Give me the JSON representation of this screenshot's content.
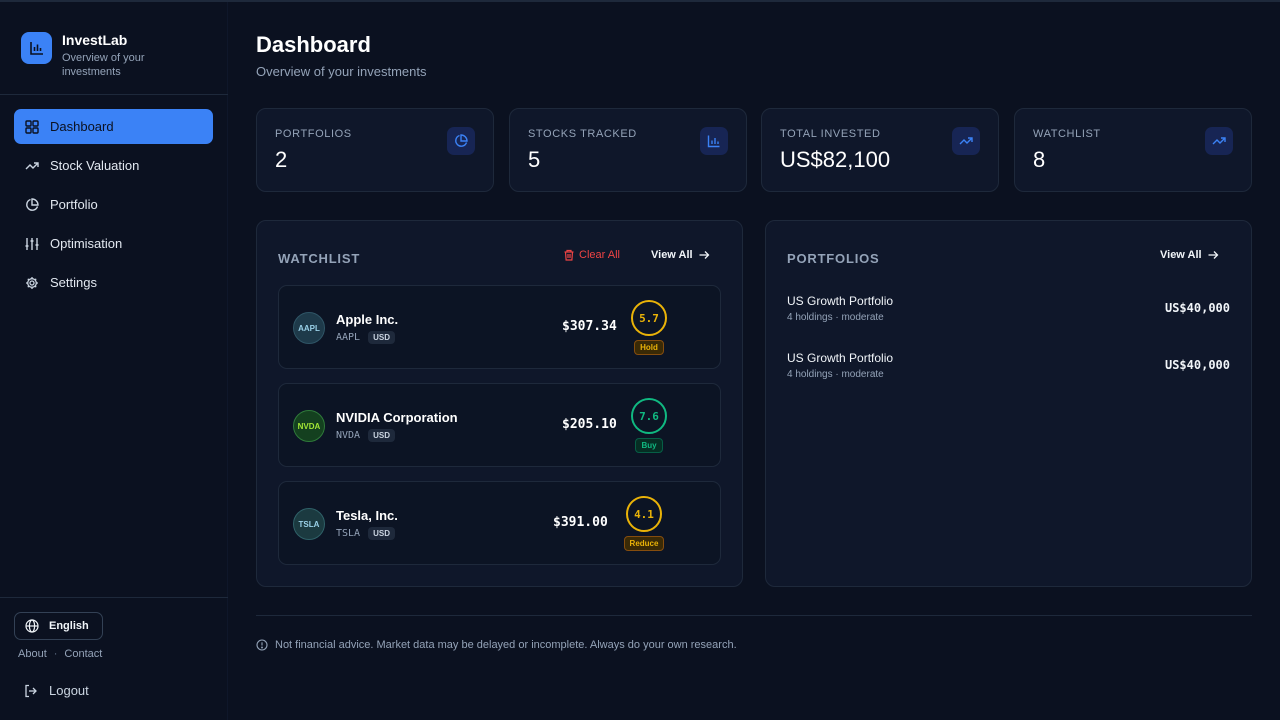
{
  "app": {
    "name": "InvestLab",
    "tagline": "Overview of your investments"
  },
  "sidebar": {
    "items": [
      {
        "label": "Dashboard",
        "icon": "grid-icon",
        "active": true
      },
      {
        "label": "Stock Valuation",
        "icon": "trend-icon",
        "active": false
      },
      {
        "label": "Portfolio",
        "icon": "pie-icon",
        "active": false
      },
      {
        "label": "Optimisation",
        "icon": "sliders-icon",
        "active": false
      },
      {
        "label": "Settings",
        "icon": "gear-icon",
        "active": false
      }
    ],
    "language": "English",
    "links": [
      "About",
      "Contact"
    ],
    "logout": "Logout"
  },
  "header": {
    "title": "Dashboard",
    "subtitle": "Overview of your investments"
  },
  "stats": [
    {
      "label": "PORTFOLIOS",
      "value": "2",
      "icon": "pie-icon"
    },
    {
      "label": "STOCKS TRACKED",
      "value": "5",
      "icon": "bar-chart-icon"
    },
    {
      "label": "TOTAL INVESTED",
      "value": "US$82,100",
      "icon": "trend-up-icon"
    },
    {
      "label": "WATCHLIST",
      "value": "8",
      "icon": "trend-up-icon"
    }
  ],
  "watchlist": {
    "title": "WATCHLIST",
    "clear_all": "Clear All",
    "view_all": "View All",
    "items": [
      {
        "logo": "AAPL",
        "name": "Apple Inc.",
        "ticker": "AAPL",
        "currency": "USD",
        "price": "$307.34",
        "score": "5.7",
        "rating": "Hold",
        "color": "#eab308"
      },
      {
        "logo": "NVDA",
        "name": "NVIDIA Corporation",
        "ticker": "NVDA",
        "currency": "USD",
        "price": "$205.10",
        "score": "7.6",
        "rating": "Buy",
        "color": "#10b981"
      },
      {
        "logo": "TSLA",
        "name": "Tesla, Inc.",
        "ticker": "TSLA",
        "currency": "USD",
        "price": "$391.00",
        "score": "4.1",
        "rating": "Reduce",
        "color": "#eab308"
      }
    ]
  },
  "portfolios": {
    "title": "PORTFOLIOS",
    "view_all": "View All",
    "items": [
      {
        "name": "US Growth Portfolio",
        "meta": "4 holdings · moderate",
        "value": "US$40,000"
      },
      {
        "name": "US Growth Portfolio",
        "meta": "4 holdings · moderate",
        "value": "US$40,000"
      }
    ]
  },
  "footer": {
    "disclaimer": "Not financial advice. Market data may be delayed or incomplete. Always do your own research."
  },
  "colors": {
    "accent": "#3b82f6",
    "danger": "#ef4444",
    "background": "#0b1120",
    "card": "#0f172a"
  }
}
